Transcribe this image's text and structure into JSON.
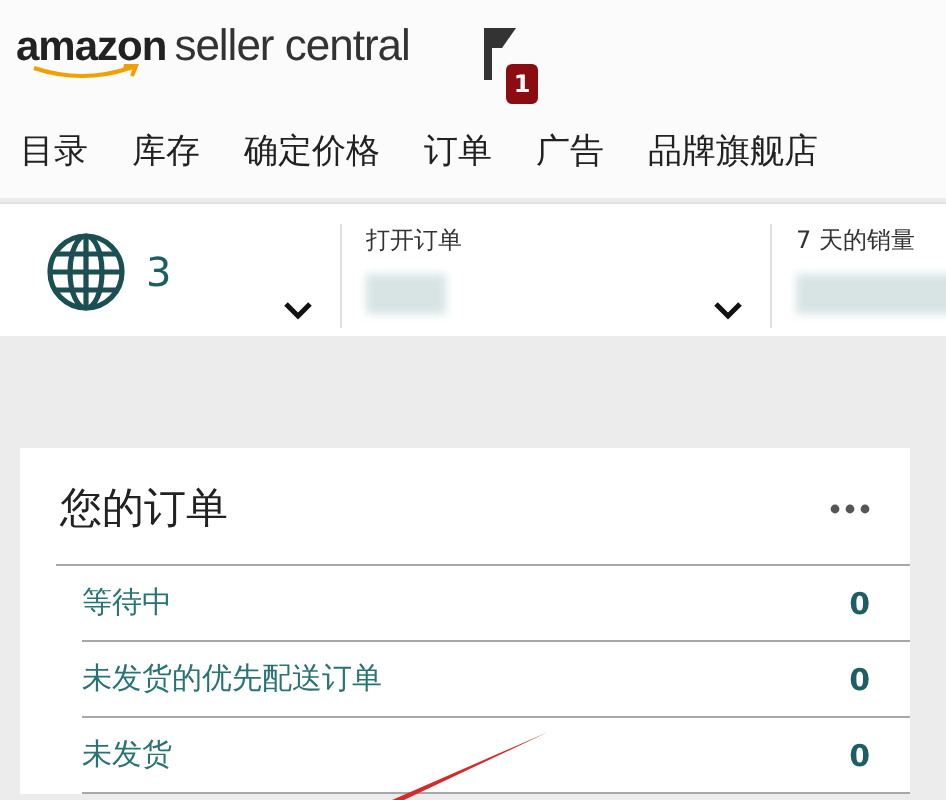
{
  "header": {
    "logo_brand": "amazon",
    "logo_product": "seller central",
    "notification_count": "1"
  },
  "nav": [
    {
      "label": "目录"
    },
    {
      "label": "库存"
    },
    {
      "label": "确定价格"
    },
    {
      "label": "订单"
    },
    {
      "label": "广告"
    },
    {
      "label": "品牌旗舰店"
    }
  ],
  "stats": [
    {
      "kind": "globe",
      "value": "3"
    },
    {
      "kind": "hidden",
      "label": "打开订单"
    },
    {
      "kind": "hidden",
      "label": "7 天的销量"
    }
  ],
  "orders_card": {
    "title": "您的订单",
    "rows": [
      {
        "label": "等待中",
        "count": "0"
      },
      {
        "label": "未发货的优先配送订单",
        "count": "0"
      },
      {
        "label": "未发货",
        "count": "0"
      }
    ]
  }
}
